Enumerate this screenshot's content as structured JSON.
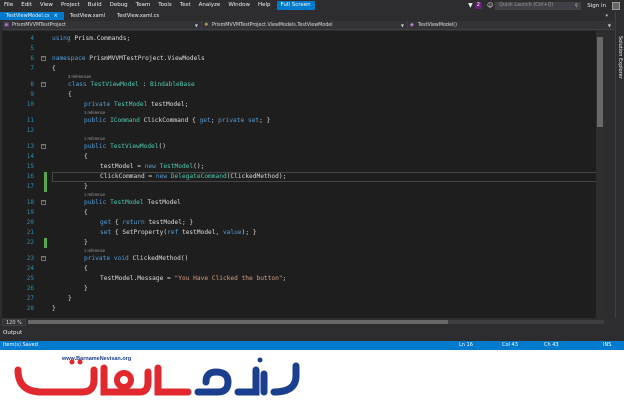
{
  "menu": {
    "items": [
      "File",
      "Edit",
      "View",
      "Project",
      "Build",
      "Debug",
      "Team",
      "Tools",
      "Test",
      "Analyze",
      "Window",
      "Help"
    ],
    "full_screen": "Full Screen",
    "notifications": "2",
    "quick_launch_placeholder": "Quick Launch (Ctrl+Q)",
    "sign_in": "Sign in"
  },
  "tabs": [
    {
      "label": "TestViewModel.cs",
      "active": true
    },
    {
      "label": "TestView.xaml",
      "active": false
    },
    {
      "label": "TestView.xaml.cs",
      "active": false
    }
  ],
  "navbar": {
    "project": "PrismMVVMTestProject",
    "type": "PrismMVVMTestProject.ViewModels.TestViewModel",
    "member": "TestViewModel()"
  },
  "side_tab": "Solution Explorer",
  "editor": {
    "lines": [
      {
        "num": "4",
        "segments": [
          [
            "kw",
            "using "
          ],
          [
            "pl",
            "Prism.Commands;"
          ]
        ],
        "indent": 0
      },
      {
        "num": "5",
        "segments": [],
        "indent": 0
      },
      {
        "num": "6",
        "segments": [
          [
            "kw",
            "namespace "
          ],
          [
            "pl",
            "PrismMVVMTestProject.ViewModels"
          ]
        ],
        "indent": 0,
        "fold": true
      },
      {
        "num": "7",
        "segments": [
          [
            "pl",
            "{"
          ]
        ],
        "indent": 0
      },
      {
        "num": "8",
        "lens": "2 references",
        "segments": [
          [
            "kw",
            "class "
          ],
          [
            "ty",
            "TestViewModel"
          ],
          [
            "pl",
            " : "
          ],
          [
            "ty",
            "BindableBase"
          ]
        ],
        "indent": 1,
        "fold": true
      },
      {
        "num": "9",
        "segments": [
          [
            "pl",
            "{"
          ]
        ],
        "indent": 1
      },
      {
        "num": "10",
        "segments": [
          [
            "kw",
            "private "
          ],
          [
            "ty",
            "TestModel"
          ],
          [
            "pl",
            " testModel;"
          ]
        ],
        "indent": 2
      },
      {
        "num": "11",
        "lens": "1 reference",
        "segments": [
          [
            "kw",
            "public "
          ],
          [
            "ty",
            "ICommand"
          ],
          [
            "pl",
            " ClickCommand { "
          ],
          [
            "kw",
            "get"
          ],
          [
            "pl",
            "; "
          ],
          [
            "kw",
            "private set"
          ],
          [
            "pl",
            "; }"
          ]
        ],
        "indent": 2
      },
      {
        "num": "12",
        "segments": [],
        "indent": 0
      },
      {
        "num": "13",
        "lens": "1 reference",
        "segments": [
          [
            "kw",
            "public "
          ],
          [
            "ty",
            "TestViewModel"
          ],
          [
            "pl",
            "()"
          ]
        ],
        "indent": 2,
        "fold": true
      },
      {
        "num": "14",
        "segments": [
          [
            "pl",
            "{"
          ]
        ],
        "indent": 2
      },
      {
        "num": "15",
        "segments": [
          [
            "pl",
            "testModel = "
          ],
          [
            "kw",
            "new "
          ],
          [
            "ty",
            "TestModel"
          ],
          [
            "pl",
            "();"
          ]
        ],
        "indent": 3
      },
      {
        "num": "16",
        "segments": [
          [
            "pl",
            "ClickCommand = "
          ],
          [
            "kw",
            "new "
          ],
          [
            "ty",
            "DelegateCommand"
          ],
          [
            "pl",
            "(ClickedMethod);"
          ]
        ],
        "indent": 3,
        "current": true,
        "changed": true
      },
      {
        "num": "17",
        "segments": [
          [
            "pl",
            "}"
          ]
        ],
        "indent": 2,
        "changed": true
      },
      {
        "num": "18",
        "lens": "1 reference",
        "segments": [
          [
            "kw",
            "public "
          ],
          [
            "ty",
            "TestModel"
          ],
          [
            "pl",
            " TestModel"
          ]
        ],
        "indent": 2,
        "fold": true
      },
      {
        "num": "19",
        "segments": [
          [
            "pl",
            "{"
          ]
        ],
        "indent": 2
      },
      {
        "num": "20",
        "segments": [
          [
            "kw",
            "get "
          ],
          [
            "pl",
            "{ "
          ],
          [
            "kw",
            "return "
          ],
          [
            "pl",
            "testModel; }"
          ]
        ],
        "indent": 3
      },
      {
        "num": "21",
        "segments": [
          [
            "kw",
            "set "
          ],
          [
            "pl",
            "{ SetProperty("
          ],
          [
            "kw",
            "ref "
          ],
          [
            "pl",
            "testModel, "
          ],
          [
            "kw",
            "value"
          ],
          [
            "pl",
            "); }"
          ]
        ],
        "indent": 3
      },
      {
        "num": "22",
        "segments": [
          [
            "pl",
            "}"
          ]
        ],
        "indent": 2,
        "changed": true
      },
      {
        "num": "23",
        "lens": "1 reference",
        "segments": [
          [
            "kw",
            "private void "
          ],
          [
            "pl",
            "ClickedMethod()"
          ]
        ],
        "indent": 2,
        "fold": true
      },
      {
        "num": "24",
        "segments": [
          [
            "pl",
            "{"
          ]
        ],
        "indent": 2
      },
      {
        "num": "25",
        "segments": [
          [
            "pl",
            "TestModel.Message = "
          ],
          [
            "st",
            "\"You Have Clicked the button\""
          ],
          [
            "pl",
            ";"
          ]
        ],
        "indent": 3
      },
      {
        "num": "26",
        "segments": [
          [
            "pl",
            "}"
          ]
        ],
        "indent": 2
      },
      {
        "num": "27",
        "segments": [
          [
            "pl",
            "}"
          ]
        ],
        "indent": 1
      },
      {
        "num": "28",
        "segments": [
          [
            "pl",
            "}"
          ]
        ],
        "indent": 0
      }
    ]
  },
  "zoom": "120 %",
  "output_label": "Output",
  "status": {
    "message": "Item(s) Saved",
    "ln": "Ln 16",
    "col": "Col 43",
    "ch": "Ch 43",
    "mode": "INS"
  },
  "logo": {
    "url": "www.BarnameNevisan.org",
    "wordmark": "برنامه نویسان"
  },
  "colors": {
    "accent": "#007acc",
    "keyword": "#569cd6",
    "type": "#4ec9b0",
    "string": "#d69d85",
    "logo_red": "#e0282e",
    "logo_blue": "#1b3f8f"
  }
}
